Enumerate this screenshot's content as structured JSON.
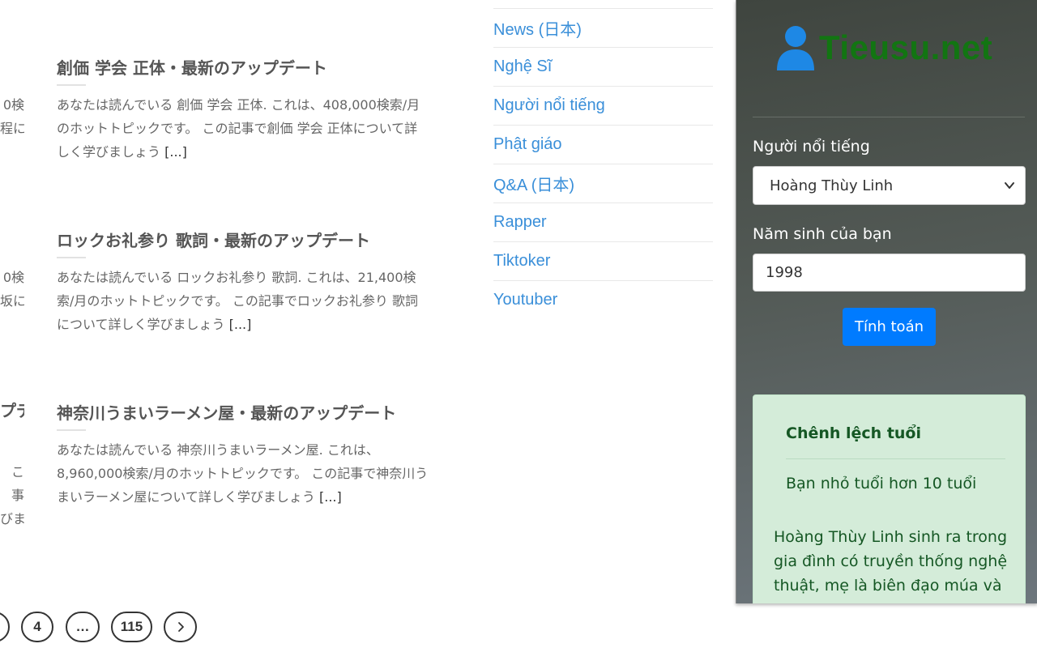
{
  "articles": [
    {
      "title": "創価 学会 正体・最新のアップデート",
      "excerpt": "あなたは読んでいる 創価 学会 正体. これは、408,000検索/月のホットトピックです。 この記事で創価 学会 正体について詳しく学びましょう",
      "read_more": "[...]"
    },
    {
      "title": "ロックお礼参り 歌詞・最新のアップデート",
      "excerpt": "あなたは読んでいる ロックお礼参り 歌詞. これは、21,400検索/月のホットトピックです。 この記事でロックお礼参り 歌詞について詳しく学びましょう",
      "read_more": "[...]"
    },
    {
      "title": "神奈川うまいラーメン屋・最新のアップデート",
      "excerpt": "あなたは読んでいる 神奈川うまいラーメン屋. これは、8,960,000検索/月のホットトピックです。 この記事で神奈川うまいラーメン屋について詳しく学びましょう",
      "read_more": "[...]"
    }
  ],
  "left_fragments": {
    "a1": "0検",
    "a2": "程に",
    "b1": "0検",
    "b2": "坂に",
    "c_title": "プデ",
    "c1": "こ",
    "c2": "事",
    "c3": "びま"
  },
  "pagination": {
    "page_4": "4",
    "ellipsis": "…",
    "last_page": "115"
  },
  "categories": [
    "News (日本)",
    "Nghệ Sĩ",
    "Người nổi tiếng",
    "Phật giáo",
    "Q&A (日本)",
    "Rapper",
    "Tiktoker",
    "Youtuber"
  ],
  "widget": {
    "logo_text": "Tieusu.net",
    "celebrity_label": "Người nổi tiếng",
    "celebrity_selected": "Hoàng Thùy Linh",
    "birth_year_label": "Năm sinh của bạn",
    "birth_year_value": "1998",
    "calculate_label": "Tính toán",
    "result_title": "Chênh lệch tuổi",
    "result_text": "Bạn nhỏ tuổi hơn 10 tuổi",
    "bio_text": "Hoàng Thùy Linh sinh ra trong gia đình có truyền thống nghệ thuật, mẹ là biên đạo múa và"
  },
  "colors": {
    "link_blue": "#3a8fd9",
    "logo_blue": "#1e88e5",
    "logo_green": "#127512",
    "button_blue": "#007bff",
    "result_bg": "#d4ecd9",
    "result_text": "#155724"
  }
}
